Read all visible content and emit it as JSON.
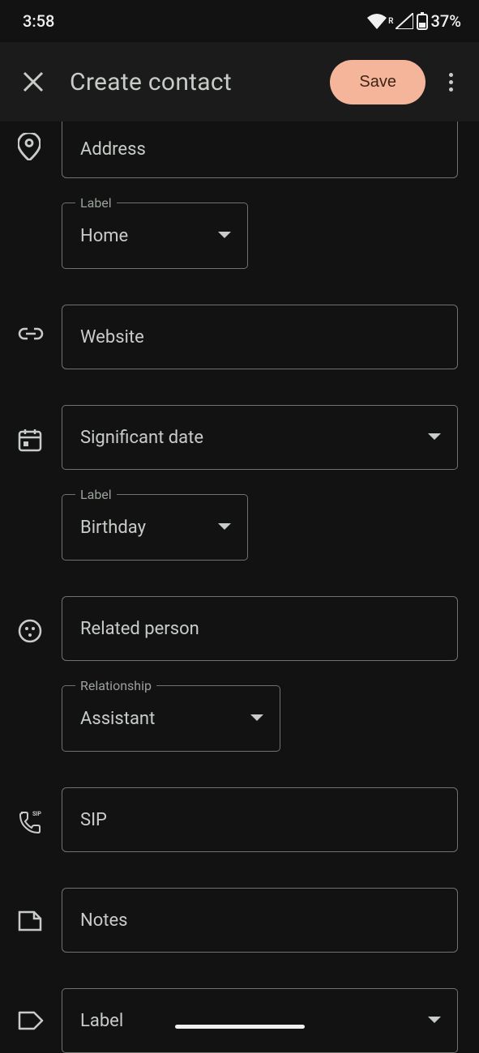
{
  "statusBar": {
    "time": "3:58",
    "battery": "37%",
    "roaming": "R"
  },
  "appBar": {
    "title": "Create contact",
    "saveLabel": "Save"
  },
  "fields": {
    "address": {
      "placeholder": "Address"
    },
    "addressLabel": {
      "label": "Label",
      "value": "Home"
    },
    "website": {
      "placeholder": "Website"
    },
    "sigDate": {
      "placeholder": "Significant date"
    },
    "sigDateLabel": {
      "label": "Label",
      "value": "Birthday"
    },
    "related": {
      "placeholder": "Related person"
    },
    "relatedLabel": {
      "label": "Relationship",
      "value": "Assistant"
    },
    "sip": {
      "placeholder": "SIP"
    },
    "notes": {
      "placeholder": "Notes"
    },
    "label": {
      "placeholder": "Label"
    }
  }
}
